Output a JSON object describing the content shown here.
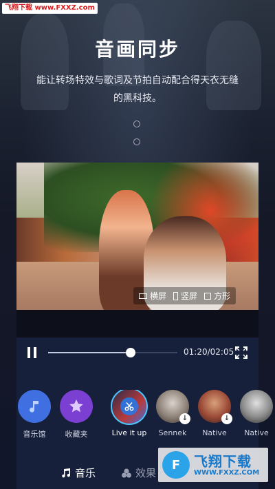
{
  "watermark": {
    "text": "飞翔下载 www.FXXZ.com"
  },
  "header": {
    "title": "音画同步",
    "subtitle_line1": "能让转场特效与歌词及节拍自动配合得天衣无缝",
    "subtitle_line2": "的黑科技。"
  },
  "pager": {
    "count": 2
  },
  "preview": {
    "orientation": [
      {
        "label": "横屏",
        "icon": "landscape-icon"
      },
      {
        "label": "竖屏",
        "icon": "portrait-icon"
      },
      {
        "label": "方形",
        "icon": "square-icon"
      }
    ]
  },
  "player": {
    "time": "01:20/02:05",
    "progress": 0.64,
    "play_icon": "pause-icon",
    "fullscreen_icon": "fullscreen-icon"
  },
  "music": {
    "items": [
      {
        "label": "音乐馆",
        "icon": "music-note-icon",
        "color": "#3f6fe0"
      },
      {
        "label": "收藏夹",
        "icon": "star-icon",
        "color": "#7b3fd2"
      },
      {
        "label": "Live it up",
        "icon": "scissors-icon",
        "selected": true
      },
      {
        "label": "Sennek",
        "download": true
      },
      {
        "label": "Native",
        "download": true
      },
      {
        "label": "Native"
      }
    ]
  },
  "tabs": [
    {
      "label": "音乐",
      "icon": "music-note-icon",
      "active": true
    },
    {
      "label": "效果",
      "icon": "effects-icon"
    }
  ],
  "brand_logo": {
    "name": "飞翔下载",
    "url": "WWW.FXXZ.COM",
    "mark": "F"
  },
  "colors": {
    "accent": "#4cc6ff",
    "panel": "#17203a",
    "watermark_red": "#d81e1e",
    "logo_blue": "#1a78c8"
  }
}
